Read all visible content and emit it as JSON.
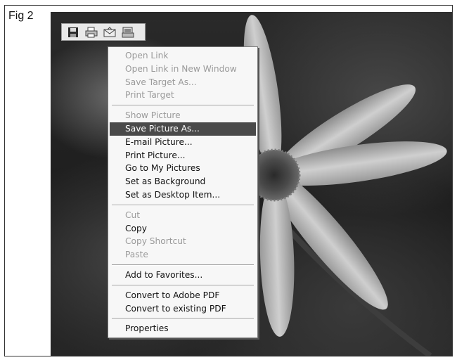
{
  "figure": {
    "label": "Fig 2"
  },
  "toolbar": {
    "buttons": [
      {
        "icon": "save-icon"
      },
      {
        "icon": "print-icon"
      },
      {
        "icon": "email-icon"
      },
      {
        "icon": "my-pictures-icon"
      }
    ]
  },
  "context_menu": {
    "groups": [
      [
        {
          "label": "Open Link",
          "enabled": false
        },
        {
          "label": "Open Link in New Window",
          "enabled": false
        },
        {
          "label": "Save Target As...",
          "enabled": false
        },
        {
          "label": "Print Target",
          "enabled": false
        }
      ],
      [
        {
          "label": "Show Picture",
          "enabled": false
        },
        {
          "label": "Save Picture As...",
          "enabled": true,
          "selected": true
        },
        {
          "label": "E-mail Picture...",
          "enabled": true
        },
        {
          "label": "Print Picture...",
          "enabled": true
        },
        {
          "label": "Go to My Pictures",
          "enabled": true
        },
        {
          "label": "Set as Background",
          "enabled": true
        },
        {
          "label": "Set as Desktop Item...",
          "enabled": true
        }
      ],
      [
        {
          "label": "Cut",
          "enabled": false
        },
        {
          "label": "Copy",
          "enabled": true
        },
        {
          "label": "Copy Shortcut",
          "enabled": false
        },
        {
          "label": "Paste",
          "enabled": false
        }
      ],
      [
        {
          "label": "Add to Favorites...",
          "enabled": true
        }
      ],
      [
        {
          "label": "Convert to Adobe PDF",
          "enabled": true
        },
        {
          "label": "Convert to existing PDF",
          "enabled": true
        }
      ],
      [
        {
          "label": "Properties",
          "enabled": true
        }
      ]
    ]
  }
}
